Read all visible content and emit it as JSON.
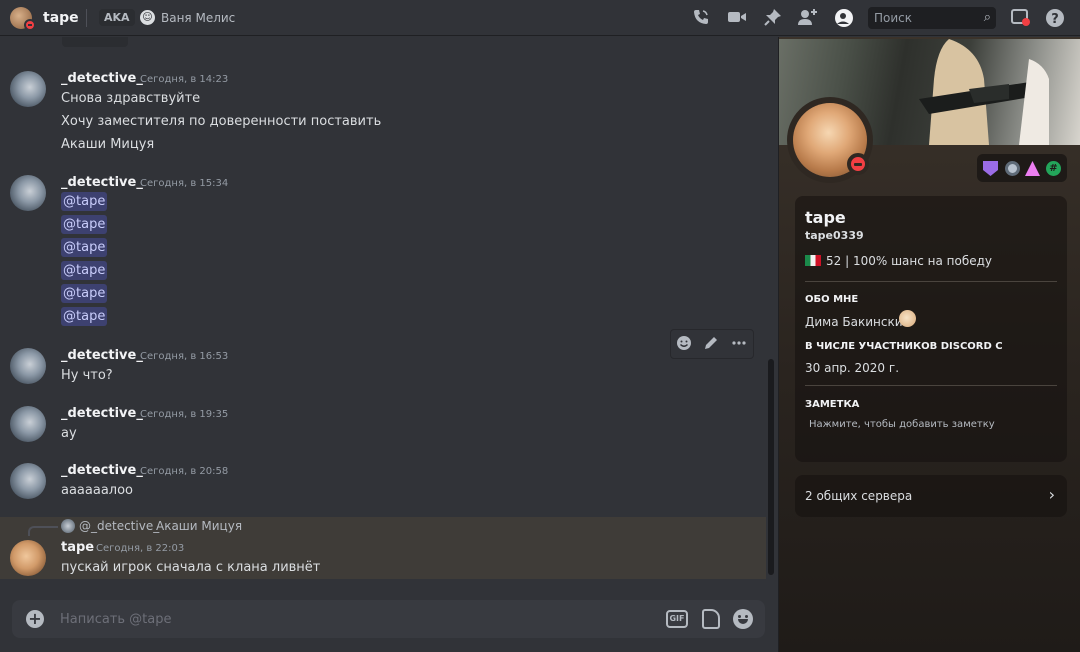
{
  "header": {
    "username": "tape",
    "aka_label": "AKA",
    "nickname": "Ваня Мелис",
    "search_placeholder": "Поиск",
    "icons": [
      "call-icon",
      "video-icon",
      "pin-icon",
      "add-friend-icon",
      "profile-toggle-icon",
      "search-icon",
      "inbox-icon",
      "help-icon"
    ]
  },
  "messages": [
    {
      "author": "_detective_",
      "time": "Сегодня, в 14:23",
      "lines": [
        "Снова здравствуйте",
        "Хочу заместителя по доверенности поставить",
        "Акаши Мицуя"
      ]
    },
    {
      "author": "_detective_",
      "time": "Сегодня, в 15:34",
      "mentions": [
        "@tape",
        "@tape",
        "@tape",
        "@tape",
        "@tape",
        "@tape"
      ]
    },
    {
      "author": "_detective_",
      "time": "Сегодня, в 16:53",
      "lines": [
        "Ну что?"
      ]
    },
    {
      "author": "_detective_",
      "time": "Сегодня, в 19:35",
      "lines": [
        "ау"
      ]
    },
    {
      "author": "_detective_",
      "time": "Сегодня, в 20:58",
      "lines": [
        "аааааалоо"
      ]
    },
    {
      "author": "tape",
      "time": "Сегодня, в 22:03",
      "reply_to_author": "@_detective_",
      "reply_to_text": "Акаши Мицуя",
      "lines": [
        "пускай игрок сначала с клана ливнёт"
      ]
    }
  ],
  "hover_actions": [
    "add-reaction-icon",
    "edit-icon",
    "more-icon"
  ],
  "composer": {
    "placeholder": "Написать @tape",
    "gif_label": "GIF"
  },
  "profile": {
    "display_name": "tape",
    "username": "tape0339",
    "custom_status": "52 | 100% шанс на победу",
    "about_title": "ОБО МНЕ",
    "about_text": "Дима Бакинский",
    "member_since_title": "В ЧИСЛЕ УЧАСТНИКОВ DISCORD С",
    "member_since": "30 апр. 2020 г.",
    "note_title": "ЗАМЕТКА",
    "note_placeholder": "Нажмите, чтобы добавить заметку",
    "mutual_servers": "2 общих сервера",
    "badges": [
      "hypesquad-badge",
      "nitro-badge",
      "boost-badge",
      "hashtag-badge"
    ]
  },
  "colors": {
    "background": "#313338",
    "mention_bg": "#5865f2",
    "dnd_status": "#f23f43",
    "badge_green": "#23a55a"
  }
}
